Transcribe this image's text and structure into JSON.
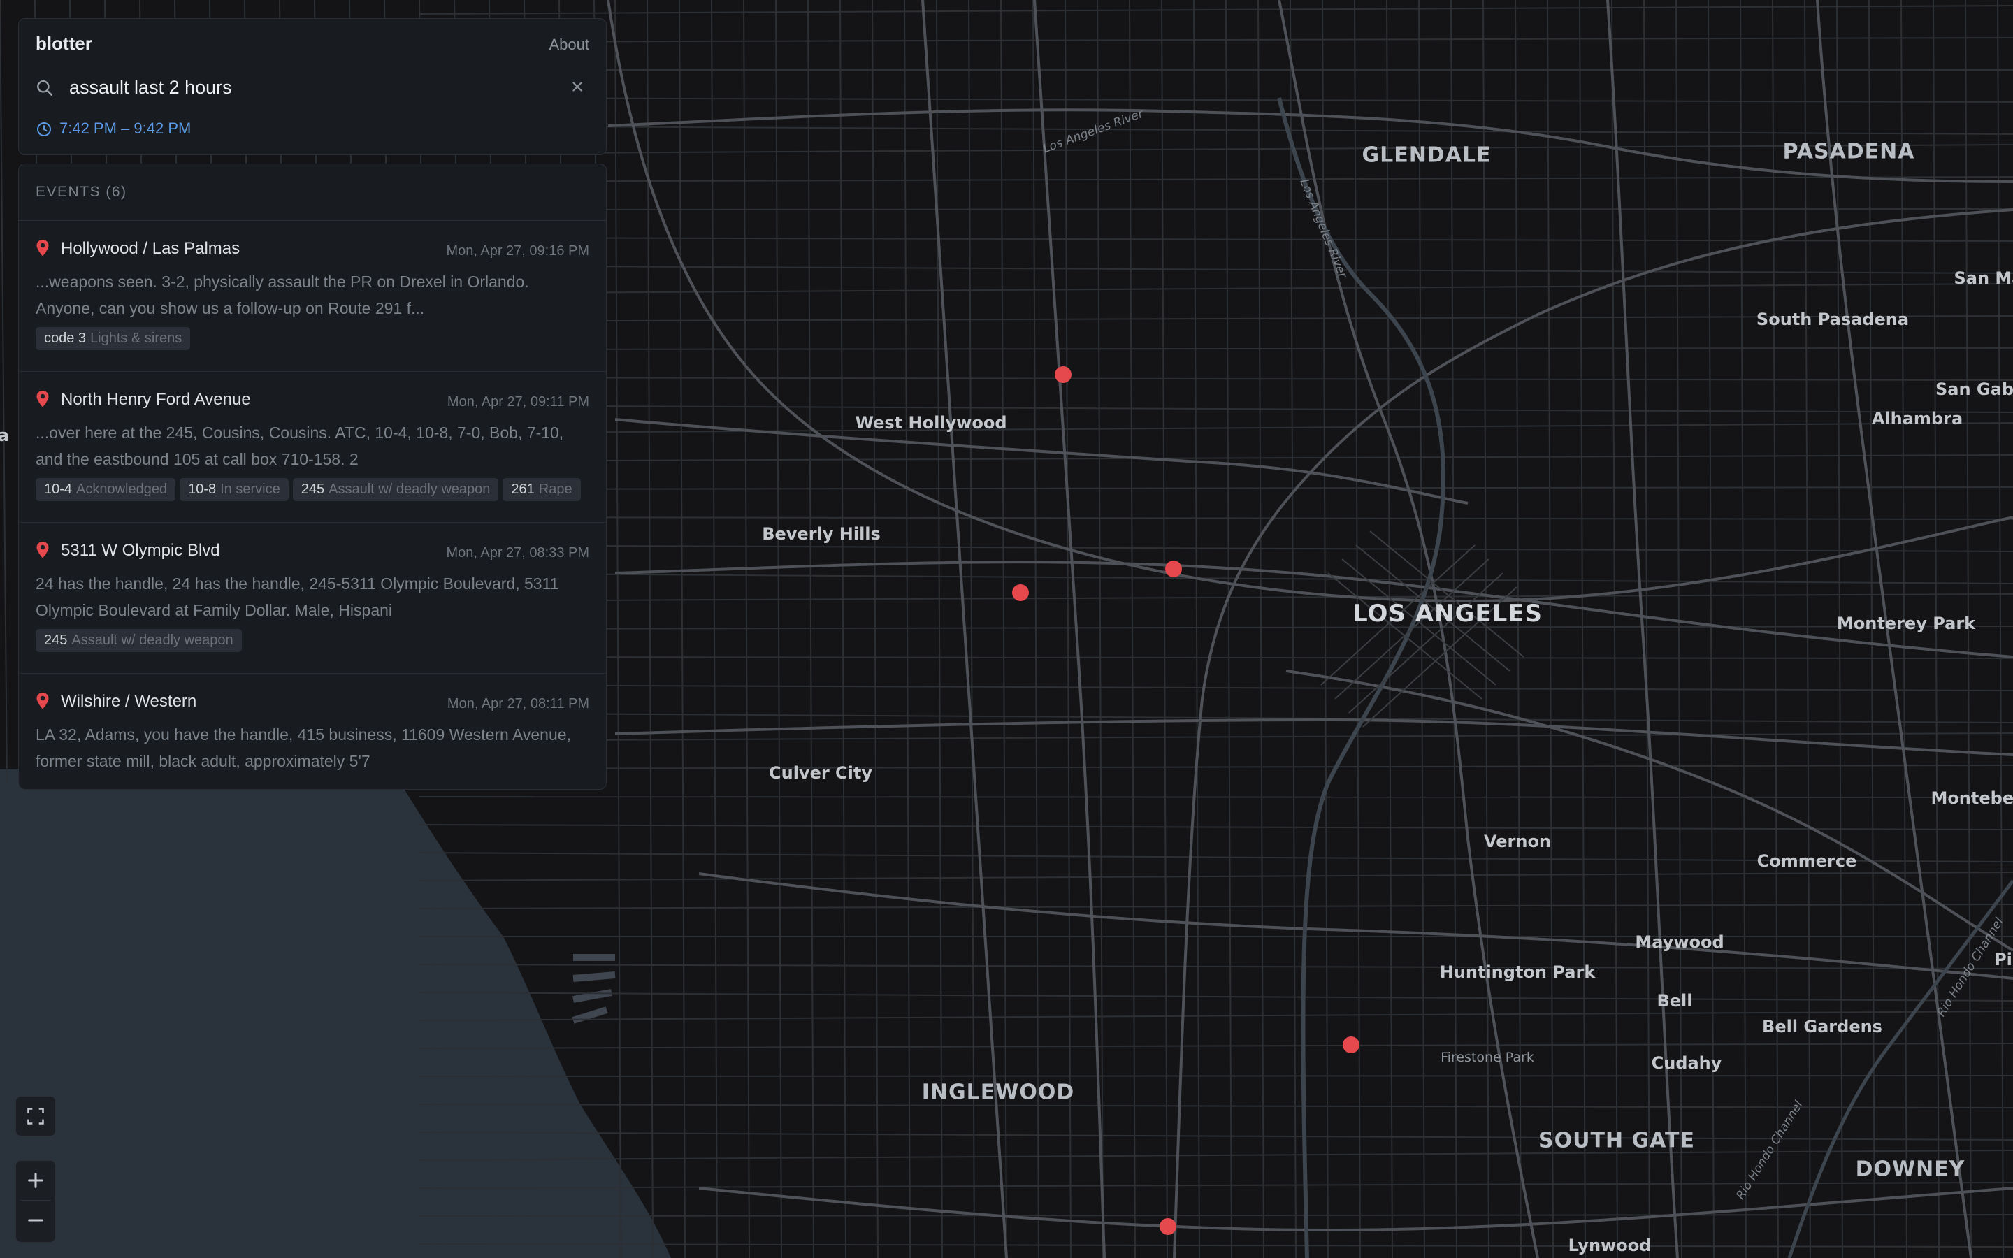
{
  "app": {
    "title": "blotter",
    "about_label": "About"
  },
  "search": {
    "query": "assault last 2 hours",
    "time_range": "7:42 PM – 9:42 PM"
  },
  "events": {
    "header": "EVENTS (6)",
    "items": [
      {
        "location": "Hollywood / Las Palmas",
        "time": "Mon, Apr 27, 09:16 PM",
        "snippet": "...weapons seen. 3-2, physically assault the PR on Drexel in Orlando. Anyone, can you show us a follow-up on Route 291 f...",
        "tags": [
          {
            "code": "code 3",
            "desc": "Lights & sirens"
          }
        ]
      },
      {
        "location": "North Henry Ford Avenue",
        "time": "Mon, Apr 27, 09:11 PM",
        "snippet": "...over here at the 245, Cousins, Cousins. ATC, 10-4, 10-8, 7-0, Bob, 7-10, and the eastbound 105 at call box 710-158. 2",
        "tags": [
          {
            "code": "10-4",
            "desc": "Acknowledged"
          },
          {
            "code": "10-8",
            "desc": "In service"
          },
          {
            "code": "245",
            "desc": "Assault w/ deadly weapon"
          },
          {
            "code": "261",
            "desc": "Rape"
          }
        ]
      },
      {
        "location": "5311 W Olympic Blvd",
        "time": "Mon, Apr 27, 08:33 PM",
        "snippet": "24 has the handle, 24 has the handle, 245-5311 Olympic Boulevard, 5311 Olympic Boulevard at Family Dollar. Male, Hispani",
        "tags": [
          {
            "code": "245",
            "desc": "Assault w/ deadly weapon"
          }
        ]
      },
      {
        "location": "Wilshire / Western",
        "time": "Mon, Apr 27, 08:11 PM",
        "snippet": "LA 32, Adams, you have the handle, 415 business, 11609 Western Avenue, former state mill, black adult, approximately 5'7",
        "tags": []
      }
    ]
  },
  "map": {
    "labels": {
      "glendale": "GLENDALE",
      "pasadena": "PASADENA",
      "san_ma": "San Ma",
      "south_pasadena": "South Pasadena",
      "san_gab": "San Gab",
      "alhambra": "Alhambra",
      "west_hollywood": "West Hollywood",
      "beverly_hills": "Beverly Hills",
      "los_angeles": "LOS ANGELES",
      "monterey_park": "Monterey Park",
      "culver_city": "Culver City",
      "montebello": "Montebell",
      "vernon": "Vernon",
      "commerce": "Commerce",
      "maywood": "Maywood",
      "huntington_park": "Huntington Park",
      "bell": "Bell",
      "bell_gardens": "Bell Gardens",
      "firestone_park": "Firestone Park",
      "cudahy": "Cudahy",
      "inglewood": "INGLEWOOD",
      "south_gate": "SOUTH GATE",
      "downey": "DOWNEY",
      "lynwood": "Lynwood",
      "pi": "Pi",
      "a_edge": "a",
      "los_angeles_river_1": "Los Angeles River",
      "los_angeles_river_2": "Los Angeles River",
      "rio_hondo_1": "Rio Hondo Channel",
      "rio_hondo_2": "Rio Hondo Channel"
    },
    "colors": {
      "land": "#141416",
      "water": "#2a323b",
      "road": "#3a3d42",
      "major_road": "#55585e",
      "marker": "#e5484d",
      "accent": "#5b9ae6"
    }
  },
  "controls": {
    "fullscreen": "fullscreen-icon",
    "zoom_in": "plus-icon",
    "zoom_out": "minus-icon"
  }
}
